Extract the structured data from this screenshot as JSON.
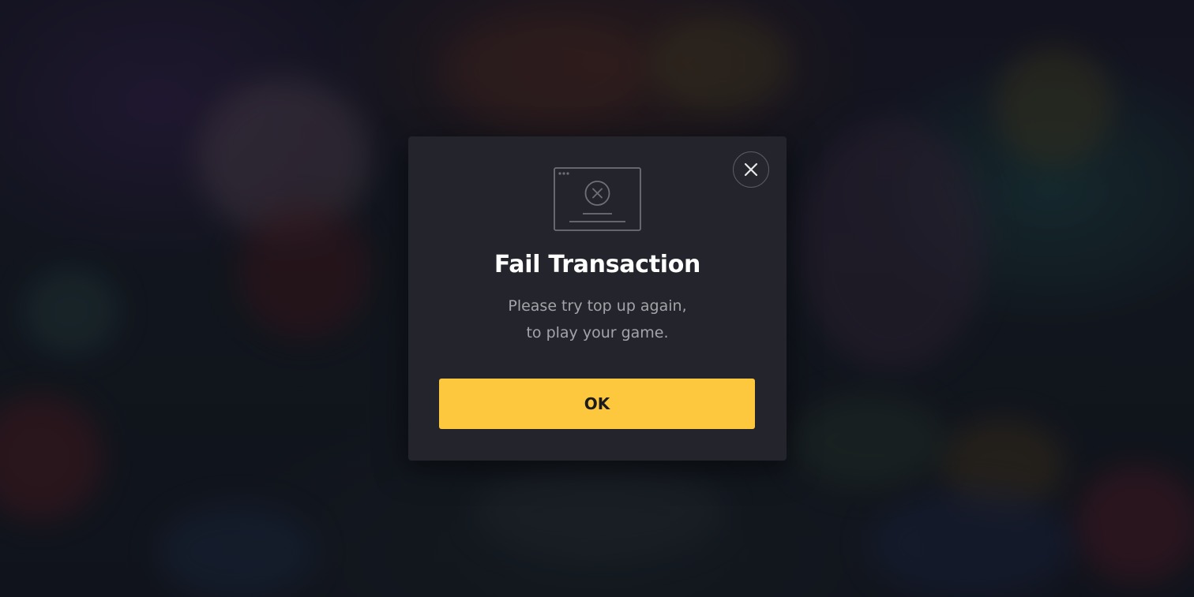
{
  "background": {
    "description_icon": "game-background-art"
  },
  "modal": {
    "icon": "transaction-failed-screen-icon",
    "close_icon": "close-icon",
    "title": "Fail Transaction",
    "message_line1": "Please try top up again,",
    "message_line2": "to play your game.",
    "ok_label": "OK"
  },
  "colors": {
    "modal_bg": "#24252c",
    "button": "#fdc83d",
    "title": "#ffffff",
    "message": "#a3a3a9"
  }
}
